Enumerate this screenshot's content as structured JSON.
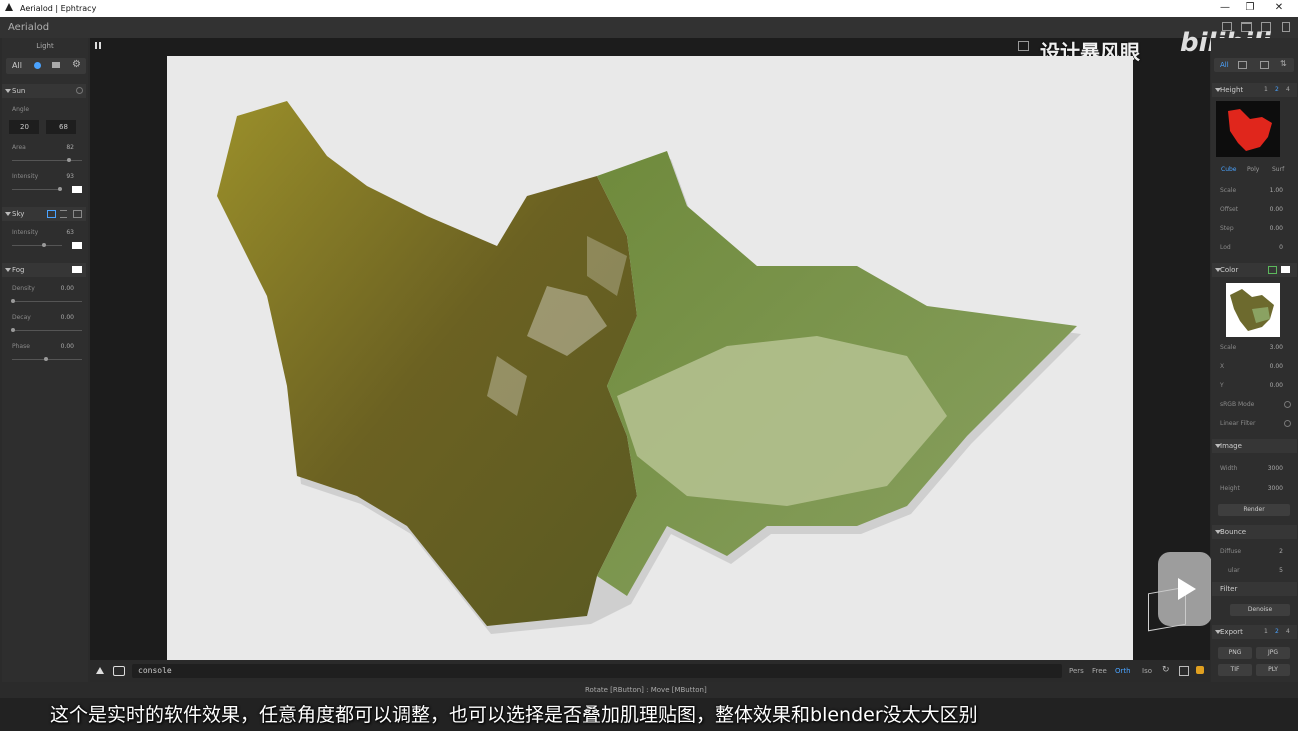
{
  "window": {
    "title": "Aerialod | Ephtracy"
  },
  "app": {
    "name": "Aerialod"
  },
  "left_panel": {
    "title": "Light",
    "tabs": [
      "All"
    ],
    "sun": {
      "label": "Sun",
      "angle_label": "Angle",
      "angle_values": [
        "20",
        "68"
      ],
      "area_label": "Area",
      "area_value": "82",
      "area_level": 0.82,
      "intensity_label": "Intensity",
      "intensity_value": "93",
      "intensity_level": 0.93
    },
    "sky": {
      "label": "Sky",
      "intensity_label": "Intensity",
      "intensity_value": "63",
      "intensity_level": 0.63
    },
    "fog": {
      "label": "Fog",
      "density_label": "Density",
      "density_value": "0.00",
      "decay_label": "Decay",
      "decay_value": "0.00",
      "phase_label": "Phase",
      "phase_value": "0.00"
    }
  },
  "right_panel": {
    "tab_all": "All",
    "height": {
      "label": "Height",
      "pages": [
        "1",
        "2",
        "4"
      ],
      "modes": [
        "Cube",
        "Poly",
        "Surf"
      ],
      "scale_label": "Scale",
      "scale_value": "1.00",
      "offset_label": "Offset",
      "offset_value": "0.00",
      "step_label": "Step",
      "step_value": "0.00",
      "lod_label": "Lod",
      "lod_value": "0"
    },
    "color": {
      "label": "Color",
      "scale_label": "Scale",
      "scale_value": "3.00",
      "x_label": "X",
      "x_value": "0.00",
      "y_label": "Y",
      "y_value": "0.00",
      "srgb_label": "sRGB Mode",
      "linear_label": "Linear Filter"
    },
    "image": {
      "label": "Image",
      "width_label": "Width",
      "width_value": "3000",
      "height_label": "Height",
      "height_value": "3000",
      "render_label": "Render"
    },
    "bounce": {
      "label": "Bounce",
      "diffuse_label": "Diffuse",
      "diffuse_value": "2",
      "other_label": "ular",
      "other_value": "5"
    },
    "filter": {
      "label": "Filter",
      "denoise_label": "Denoise"
    },
    "export": {
      "label": "Export",
      "pages": [
        "1",
        "2",
        "4"
      ],
      "buttons": [
        "PNG",
        "JPG",
        "TIF",
        "PLY"
      ]
    }
  },
  "viewport": {
    "watermark": "设计暴风眼",
    "watermark_brand": "bilibili",
    "console_text": "console",
    "view_modes": [
      "Pers",
      "Free",
      "Orth",
      "Iso"
    ],
    "active_view": "Orth",
    "hint": "Rotate [RButton] : Move [MButton]"
  },
  "subtitle": "这个是实时的软件效果，任意角度都可以调整，也可以选择是否叠加肌理贴图，整体效果和blender没太大区别",
  "colors": {
    "accent": "#4aa3ff",
    "panel": "#2e2e2e",
    "canvas_bg": "#e9e9e9"
  }
}
